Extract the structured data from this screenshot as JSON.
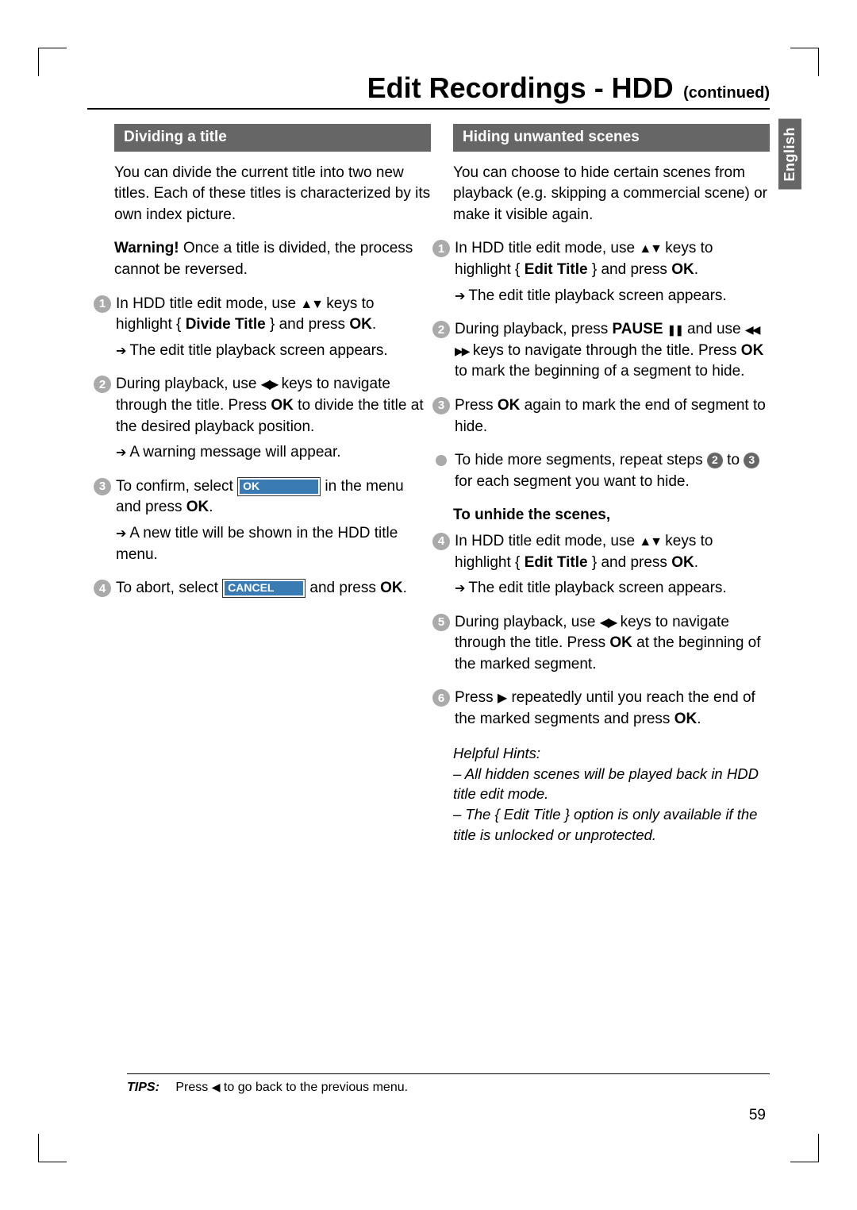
{
  "title": {
    "main": "Edit Recordings - HDD",
    "sub": "(continued)"
  },
  "lang": "English",
  "left": {
    "heading": "Dividing a title",
    "intro": "You can divide the current title into two new titles. Each of these titles is characterized by its own index picture.",
    "warning_label": "Warning!",
    "warning_text": " Once a title is divided, the process cannot be reversed.",
    "s1a": "In HDD title edit mode, use ",
    "s1b": " keys to highlight { ",
    "s1c": "Divide Title",
    "s1d": " } and press ",
    "s1e": "OK",
    "s1f": ".",
    "s1_res": "The edit title playback screen appears.",
    "s2a": "During playback, use ",
    "s2b": " keys to navigate through the title. Press ",
    "s2c": "OK",
    "s2d": " to divide the title at the desired playback position.",
    "s2_res": "A warning message will appear.",
    "s3a": "To confirm, select ",
    "s3_btn": "OK",
    "s3b": " in the menu and press ",
    "s3c": "OK",
    "s3d": ".",
    "s3_res": "A new title will be shown in the HDD title menu.",
    "s4a": "To abort, select ",
    "s4_btn": "CANCEL",
    "s4b": " and press ",
    "s4c": "OK",
    "s4d": "."
  },
  "right": {
    "heading": "Hiding unwanted scenes",
    "intro": "You can choose to hide certain scenes from playback (e.g. skipping a commercial scene) or make it visible again.",
    "s1a": "In HDD title edit mode, use ",
    "s1b": " keys to highlight { ",
    "s1c": "Edit Title",
    "s1d": " } and press ",
    "s1e": "OK",
    "s1f": ".",
    "s1_res": "The edit title playback screen appears.",
    "s2a": "During playback, press ",
    "s2b": "PAUSE ",
    "s2c": " and use ",
    "s2d": " keys to navigate through the title. Press ",
    "s2e": "OK",
    "s2f": " to mark the beginning of a segment to hide.",
    "s3a": "Press ",
    "s3b": "OK",
    "s3c": " again to mark the end of segment to hide.",
    "bul_a": "To hide more segments, repeat steps ",
    "bul_b": " to ",
    "bul_c": " for each segment you want to hide.",
    "sub": "To unhide the scenes,",
    "s4a": "In HDD title edit mode, use ",
    "s4b": " keys to highlight { ",
    "s4c": "Edit Title",
    "s4d": " } and press ",
    "s4e": "OK",
    "s4f": ".",
    "s4_res": "The edit title playback screen appears.",
    "s5a": "During playback, use ",
    "s5b": " keys to navigate through the title. Press ",
    "s5c": "OK",
    "s5d": " at the beginning of the marked segment.",
    "s6a": "Press ",
    "s6b": " repeatedly until you reach the end of the marked segments and press ",
    "s6c": "OK",
    "s6d": ".",
    "hints_label": "Helpful Hints:",
    "hint1": "– All hidden scenes will be played back in HDD title edit mode.",
    "hint2": "– The { Edit Title } option is only available if the title is unlocked or unprotected."
  },
  "tips_label": "TIPS:",
  "tips_a": "Press ",
  "tips_b": " to go back to the previous menu.",
  "page_number": "59"
}
